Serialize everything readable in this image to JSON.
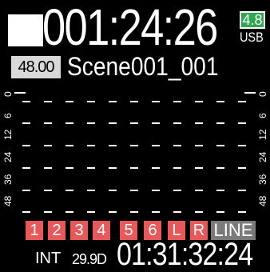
{
  "status": {
    "transport_icon": "stop-icon",
    "counter": "001:24:26",
    "battery_level": "4.8",
    "battery_color": "#2fa84f",
    "power_source": "USB"
  },
  "project": {
    "sample_rate": "48.00",
    "scene_name": "Scene001_001"
  },
  "meter_scale": [
    "0",
    "6",
    "12",
    "24",
    "36",
    "48"
  ],
  "tracks": {
    "items": [
      "1",
      "2",
      "3",
      "4",
      "5",
      "6",
      "L",
      "R"
    ],
    "input": "LINE",
    "armed_color": "#e85858"
  },
  "timecode": {
    "mode": "INT",
    "fps": "29.9D",
    "value": "01:31:32:24"
  }
}
